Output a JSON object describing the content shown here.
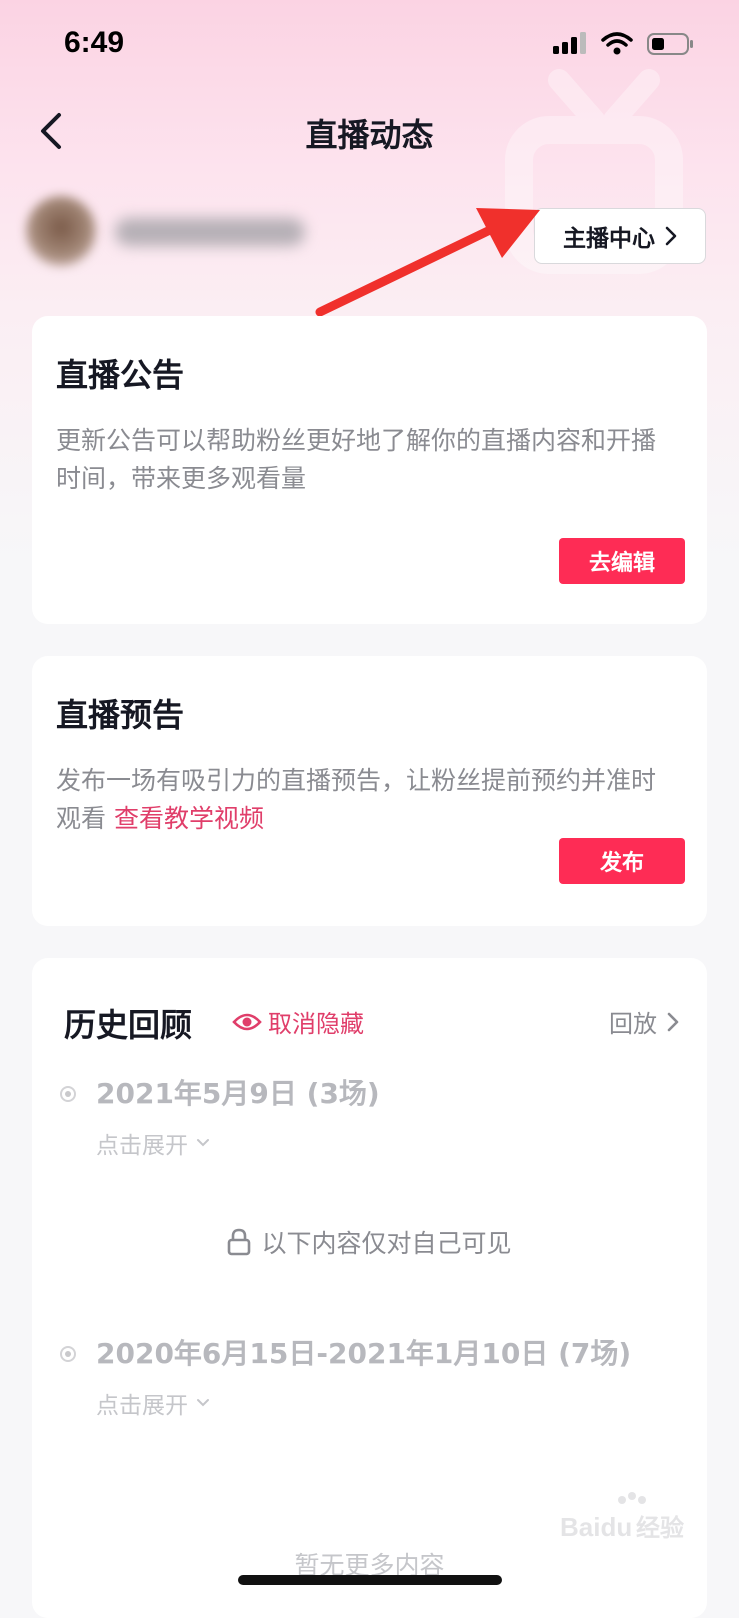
{
  "status_bar": {
    "time": "6:49"
  },
  "header": {
    "title": "直播动态"
  },
  "profile": {
    "anchor_center_label": "主播中心"
  },
  "announcement": {
    "title": "直播公告",
    "description": "更新公告可以帮助粉丝更好地了解你的直播内容和开播时间，带来更多观看量",
    "button_label": "去编辑"
  },
  "preview": {
    "title": "直播预告",
    "description": "发布一场有吸引力的直播预告，让粉丝提前预约并准时观看 ",
    "link_label": "查看教学视频",
    "button_label": "发布"
  },
  "history": {
    "title": "历史回顾",
    "unhide_label": "取消隐藏",
    "replay_label": "回放",
    "groups": [
      {
        "label": "2021年5月9日 (3场)",
        "expand_label": "点击展开"
      },
      {
        "label": "2020年6月15日-2021年1月10日 (7场)",
        "expand_label": "点击展开"
      }
    ],
    "private_note": "以下内容仅对自己可见",
    "no_more": "暂无更多内容"
  },
  "colors": {
    "accent": "#fe2c55",
    "link": "#e03e6a",
    "annotation_arrow": "#f0302c"
  },
  "watermark": {
    "text": "Baidu经验"
  }
}
